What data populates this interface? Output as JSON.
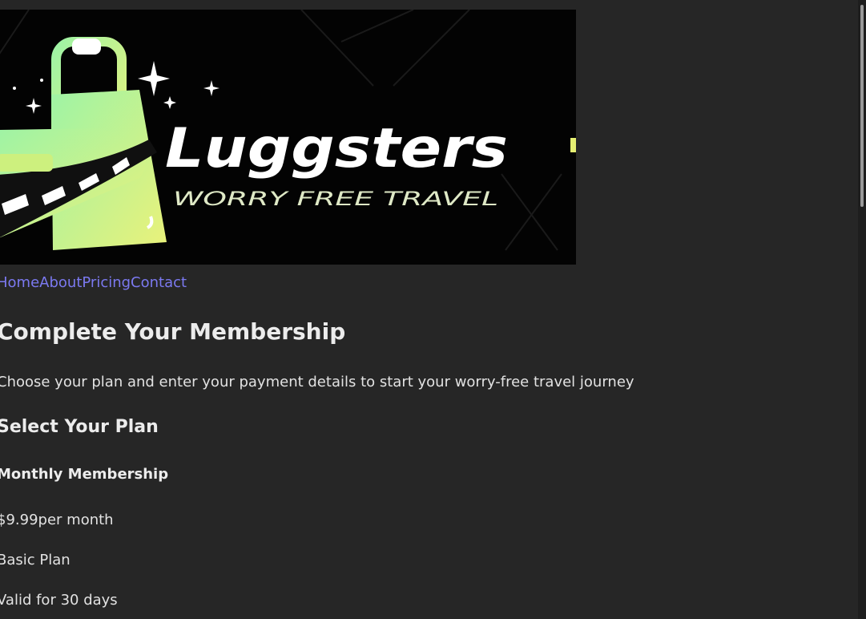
{
  "logo": {
    "brand": "Luggsters",
    "tagline": "WORRY FREE TRAVEL",
    "colors": {
      "background": "#030303",
      "gradient_start": "#9ef3a5",
      "gradient_end": "#eaf27a",
      "text": "#ffffff",
      "tagline": "#dfe9c6"
    }
  },
  "nav": {
    "home": "Home",
    "about": "About",
    "pricing": "Pricing",
    "contact": "Contact"
  },
  "page": {
    "title": "Complete Your Membership",
    "intro": "Choose your plan and enter your payment details to start your worry-free travel journey"
  },
  "plan_section": {
    "heading": "Select Your Plan",
    "plan": {
      "name": "Monthly Membership",
      "price": "$9.99",
      "period": "per month",
      "tier": "Basic Plan",
      "validity": "Valid for 30 days"
    }
  },
  "colors": {
    "background": "#262626",
    "link": "#7b79f0",
    "text": "#e6e6e6"
  }
}
